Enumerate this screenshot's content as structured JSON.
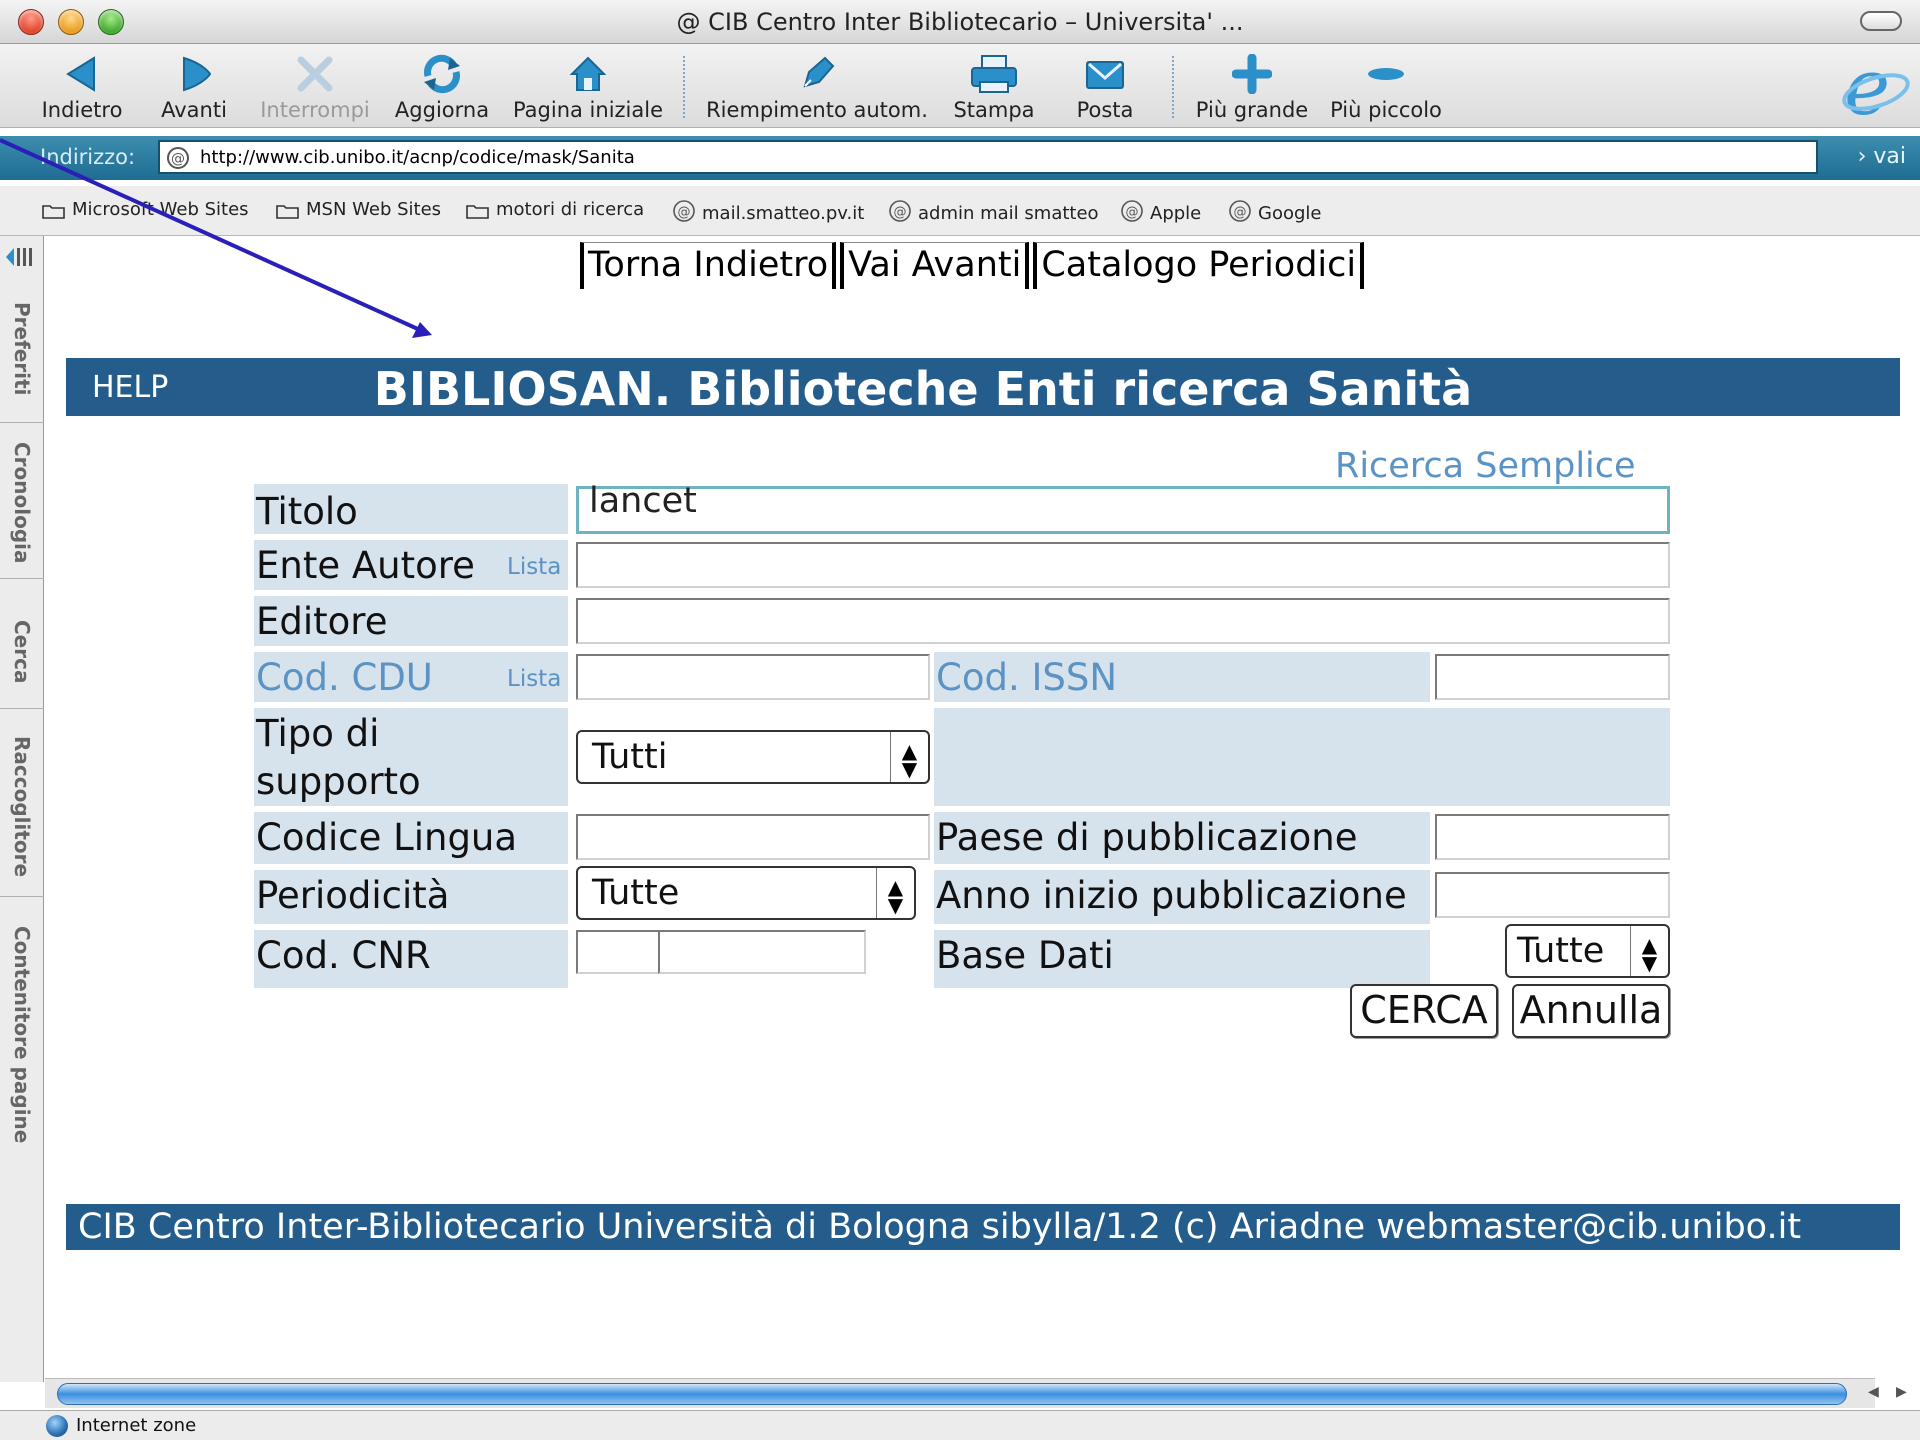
{
  "window": {
    "title": "@ CIB Centro Inter Bibliotecario – Universita' ..."
  },
  "toolbar": {
    "back": "Indietro",
    "forward": "Avanti",
    "stop": "Interrompi",
    "refresh": "Aggiorna",
    "home": "Pagina iniziale",
    "autofill": "Riempimento autom.",
    "print": "Stampa",
    "mail": "Posta",
    "larger": "Più grande",
    "smaller": "Più piccolo"
  },
  "address": {
    "label": "Indirizzo:",
    "url": "http://www.cib.unibo.it/acnp/codice/mask/Sanita",
    "go": "› vai"
  },
  "favorites": [
    "Microsoft Web Sites",
    "MSN Web Sites",
    "motori di ricerca",
    "mail.smatteo.pv.it",
    "admin mail smatteo",
    "Apple",
    "Google"
  ],
  "sidebar": {
    "tabs": [
      "Preferiti",
      "Cronologia",
      "Cerca",
      "Raccoglitore",
      "Contenitore pagine"
    ]
  },
  "page": {
    "nav": [
      "Torna Indietro",
      "Vai Avanti",
      "Catalogo Periodici"
    ],
    "help": "HELP",
    "title": "BIBLIOSAN. Biblioteche Enti ricerca Sanità",
    "simple_search": "Ricerca Semplice",
    "footer": "CIB Centro Inter-Bibliotecario Università di Bologna  sibylla/1.2 (c) Ariadne  webmaster@cib.unibo.it"
  },
  "form": {
    "titolo": {
      "label": "Titolo",
      "value": "lancet"
    },
    "ente_autore": {
      "label": "Ente Autore",
      "lista": "Lista",
      "value": ""
    },
    "editore": {
      "label": "Editore",
      "value": ""
    },
    "cod_cdu": {
      "label": "Cod. CDU",
      "lista": "Lista",
      "value": ""
    },
    "cod_issn": {
      "label": "Cod. ISSN",
      "value": ""
    },
    "tipo_supporto": {
      "label_line1": "Tipo di",
      "label_line2": "supporto",
      "selected": "Tutti"
    },
    "codice_lingua": {
      "label": "Codice Lingua",
      "value": ""
    },
    "paese": {
      "label": "Paese di pubblicazione",
      "value": ""
    },
    "periodicita": {
      "label": "Periodicità",
      "selected": "Tutte"
    },
    "anno_inizio": {
      "label": "Anno inizio pubblicazione",
      "value": ""
    },
    "cod_cnr": {
      "label": "Cod. CNR"
    },
    "base_dati": {
      "label": "Base Dati",
      "selected": "Tutte"
    },
    "search_button": "CERCA",
    "reset_button": "Annulla"
  },
  "status": {
    "zone": "Internet zone"
  },
  "colors": {
    "header_band": "#245d8c",
    "form_cell": "#d6e2ec",
    "link": "#5b93c4",
    "address_bar": "#2a7aa0",
    "annotation_arrow": "#2a1fb8"
  }
}
